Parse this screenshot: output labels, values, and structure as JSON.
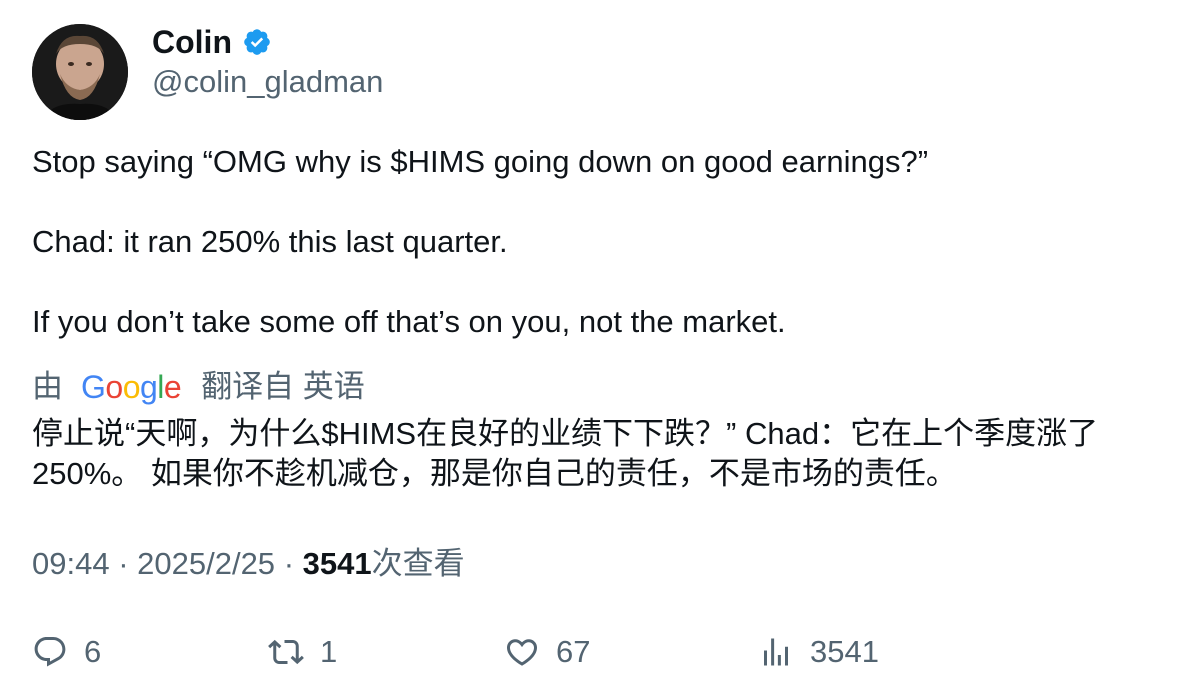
{
  "author": {
    "name": "Colin",
    "handle": "@colin_gladman",
    "verified": true,
    "verified_icon": "verified-badge-icon",
    "verified_color": "#1d9bf0"
  },
  "tweet": {
    "lines": [
      "Stop saying “OMG why is $HIMS going down on good earnings?”",
      "Chad: it ran 250% this last quarter.",
      "If you don’t take some off that’s on you, not the market."
    ]
  },
  "translation": {
    "prefix": "由",
    "provider": "Google",
    "suffix": "翻译自 英语",
    "text": "停止说“天啊，为什么$HIMS在良好的业绩下下跌？” Chad：它在上个季度涨了250%。 如果你不趁机减仓，那是你自己的责任，不是市场的责任。"
  },
  "meta": {
    "time": "09:44",
    "separator": "·",
    "date": "2025/2/25",
    "views": "3541",
    "views_label": "次查看"
  },
  "actions": {
    "replies": {
      "icon": "reply-icon",
      "count": "6"
    },
    "retweets": {
      "icon": "retweet-icon",
      "count": "1"
    },
    "likes": {
      "icon": "heart-icon",
      "count": "67"
    },
    "views": {
      "icon": "views-chart-icon",
      "count": "3541"
    }
  },
  "colors": {
    "text_primary": "#0f1419",
    "text_secondary": "#536471",
    "verified": "#1d9bf0"
  }
}
